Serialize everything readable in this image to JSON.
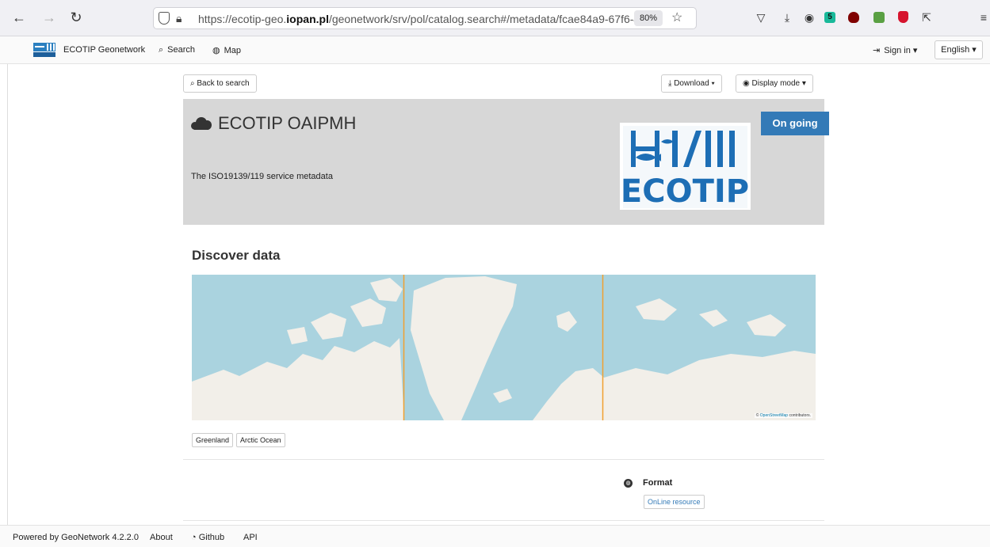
{
  "browser": {
    "url_prefix": "https://ecotip-geo.",
    "url_domain": "iopan.pl",
    "url_rest": "/geonetwork/srv/pol/catalog.search#/metadata/fcae84a9-67f6-4",
    "zoom": "80%"
  },
  "header": {
    "brand": "ECOTIP Geonetwork",
    "search_label": "Search",
    "map_label": "Map",
    "signin_label": "Sign in",
    "language_label": "English"
  },
  "toolbar": {
    "back_label": "Back to search",
    "download_label": "Download",
    "display_mode_label": "Display mode"
  },
  "record": {
    "title": "ECOTIP OAIPMH",
    "abstract": "The ISO19139/119 service metadata",
    "status": "On going",
    "logo_text": "ECOTIP"
  },
  "discover": {
    "title": "Discover data",
    "map_attribution_prefix": "©",
    "map_attribution_link": "OpenStreetMap",
    "map_attribution_suffix": "contributors.",
    "keywords": [
      "Greenland",
      "Arctic Ocean"
    ]
  },
  "format": {
    "label": "Format",
    "value": "OnLine resource"
  },
  "footer": {
    "powered": "Powered by GeoNetwork 4.2.2.0",
    "about": "About",
    "github": "Github",
    "api": "API"
  },
  "colors": {
    "status": "#337ab7",
    "sea": "#aad3df",
    "land": "#f2efe9",
    "bbox": "#f0a030"
  }
}
